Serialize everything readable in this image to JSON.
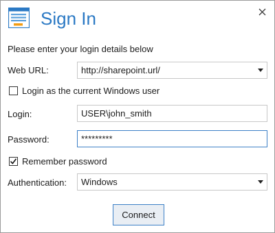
{
  "dialog": {
    "title": "Sign In"
  },
  "instructions": "Please enter your login details below",
  "web_url": {
    "label": "Web URL:",
    "value": "http://sharepoint.url/"
  },
  "login_windows": {
    "label": "Login as the current Windows user",
    "checked": false
  },
  "login": {
    "label": "Login:",
    "value": "USER\\john_smith"
  },
  "password": {
    "label": "Password:",
    "value": "*********"
  },
  "remember": {
    "label": "Remember password",
    "checked": true
  },
  "authentication": {
    "label": "Authentication:",
    "value": "Windows"
  },
  "connect_label": "Connect",
  "icons": {
    "app": "form-window-icon",
    "close": "close-icon",
    "dropdown": "chevron-down-icon",
    "check": "checkmark-icon"
  },
  "colors": {
    "accent": "#2b79c4",
    "focus_border": "#3b7fc6",
    "button_bg": "#e9eef4"
  }
}
